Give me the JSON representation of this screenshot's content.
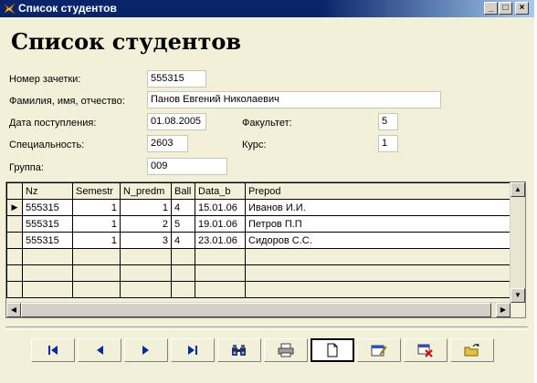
{
  "window": {
    "title": "Список студентов"
  },
  "form": {
    "heading": "Список студентов",
    "fields": {
      "record_book_label": "Номер зачетки:",
      "record_book_value": "555315",
      "fio_label": "Фамилия, имя, отчество:",
      "fio_value": "Панов Евгений Николаевич",
      "admission_label": "Дата поступления:",
      "admission_value": "01.08.2005",
      "faculty_label": "Факультет:",
      "faculty_value": "5",
      "specialty_label": "Специальность:",
      "specialty_value": "2603",
      "course_label": "Курс:",
      "course_value": "1",
      "group_label": "Группа:",
      "group_value": "009"
    }
  },
  "grid": {
    "columns": [
      "Nz",
      "Semestr",
      "N_predm",
      "Ball",
      "Data_b",
      "Prepod"
    ],
    "rows": [
      [
        "555315",
        "1",
        "1",
        "4",
        "15.01.06",
        "Иванов И.И."
      ],
      [
        "555315",
        "1",
        "2",
        "5",
        "19.01.06",
        "Петров П.П"
      ],
      [
        "555315",
        "1",
        "3",
        "4",
        "23.01.06",
        "Сидоров С.С."
      ]
    ],
    "current_row": 0
  },
  "navbar": {
    "buttons": [
      "first-record",
      "previous-record",
      "next-record",
      "last-record",
      "find",
      "print",
      "new-record",
      "edit",
      "delete",
      "open"
    ]
  },
  "colors": {
    "titlebar": "#0a246a",
    "form_background": "#f2f0d8",
    "nav_arrow": "#0a2a9a"
  }
}
